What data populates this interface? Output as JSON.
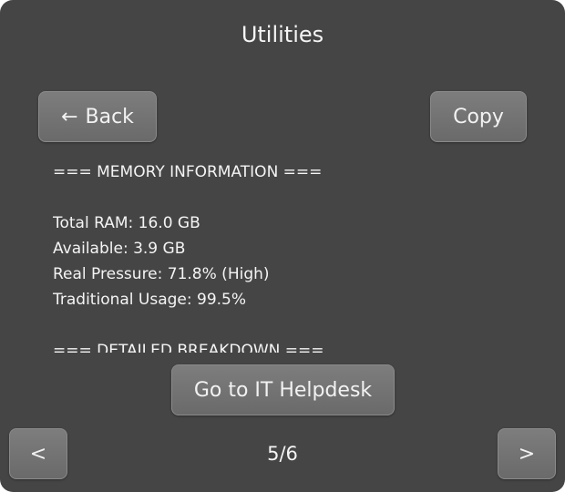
{
  "window": {
    "title": "Utilities"
  },
  "toolbar": {
    "back_label": "Back",
    "copy_label": "Copy"
  },
  "report": {
    "lines": [
      "=== MEMORY INFORMATION ===",
      "",
      "Total RAM: 16.0 GB",
      "Available: 3.9 GB",
      "Real Pressure: 71.8% (High)",
      "Traditional Usage: 99.5%",
      "",
      "=== DETAILED BREAKDOWN ==="
    ]
  },
  "helpdesk": {
    "label": "Go to IT Helpdesk"
  },
  "pagination": {
    "prev_label": "<",
    "next_label": ">",
    "indicator": "5/6"
  },
  "icons": {
    "back": "left-arrow-icon"
  },
  "colors": {
    "panel_background": "#454545",
    "button_background": "#737373",
    "text": "#f4f4f4"
  }
}
